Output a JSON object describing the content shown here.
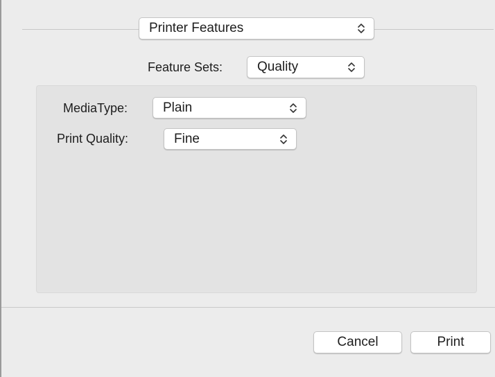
{
  "dialog": {
    "panel_selector": {
      "value": "Printer Features",
      "icon": "up-down-chevron-icon"
    },
    "feature_sets": {
      "label": "Feature Sets:",
      "value": "Quality"
    },
    "options": [
      {
        "label": "MediaType:",
        "value": "Plain"
      },
      {
        "label": "Print Quality:",
        "value": "Fine"
      }
    ],
    "buttons": {
      "cancel": "Cancel",
      "print": "Print"
    }
  }
}
